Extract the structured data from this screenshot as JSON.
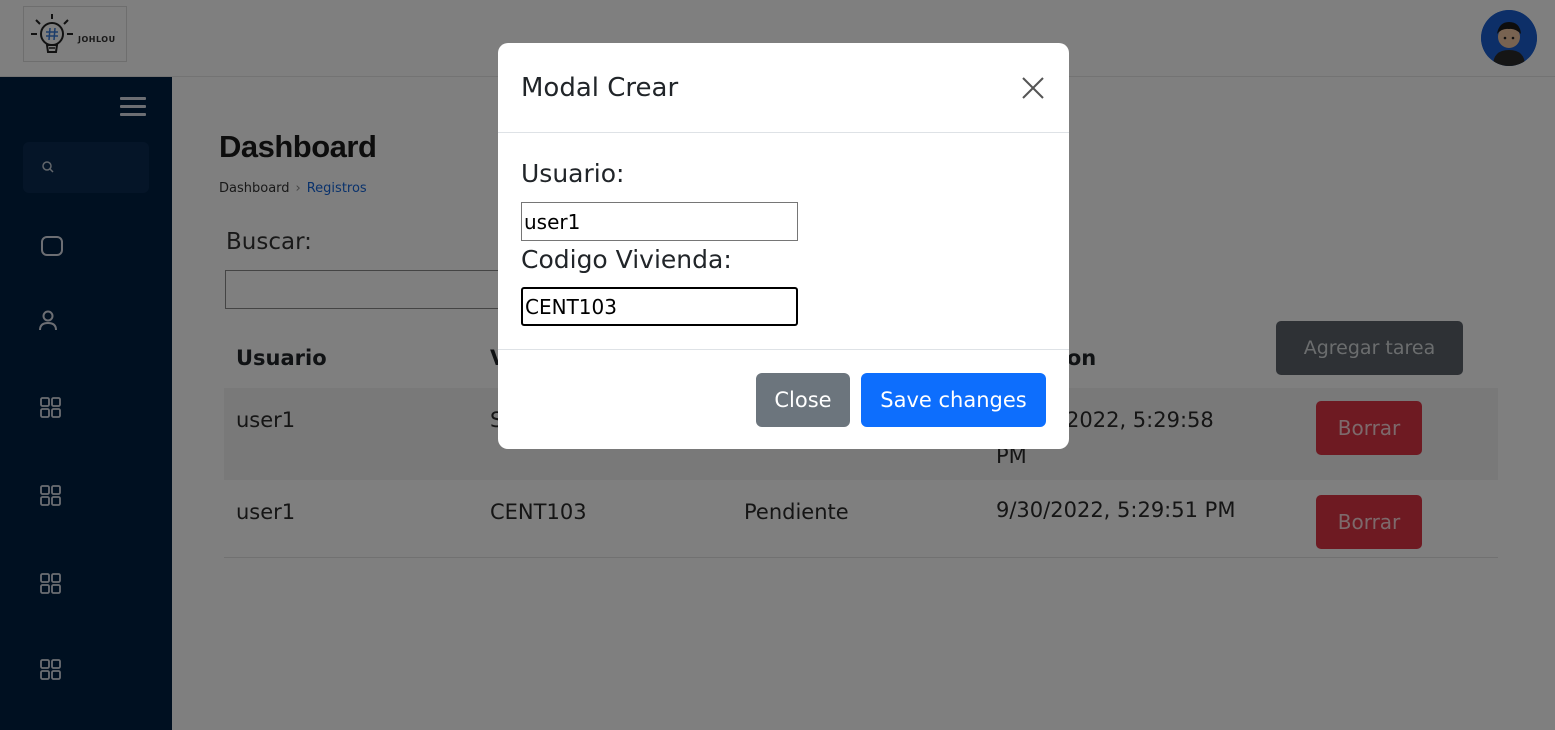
{
  "header": {
    "logo_text": "JOHLOU",
    "avatar_icon": "user-avatar-icon"
  },
  "sidebar": {
    "menu_icon": "hamburger-menu-icon",
    "search_icon": "search-icon",
    "items": [
      {
        "icon": "square-icon"
      },
      {
        "icon": "user-icon"
      },
      {
        "icon": "grid-icon"
      },
      {
        "icon": "grid-icon"
      },
      {
        "icon": "grid-icon"
      },
      {
        "icon": "grid-icon"
      }
    ]
  },
  "main": {
    "title": "Dashboard",
    "breadcrumb": {
      "root": "Dashboard",
      "separator": "›",
      "current": "Registros"
    },
    "search_label": "Buscar:",
    "search_value": "",
    "add_button": "Agregar tarea",
    "table": {
      "headers": [
        "Usuario",
        "V",
        "",
        "creacion"
      ],
      "rows": [
        {
          "usuario": "user1",
          "vivienda": "S",
          "estado": "",
          "fecha_line1": "2022, 5:29:58",
          "fecha_line2": "PM",
          "action": "Borrar"
        },
        {
          "usuario": "user1",
          "vivienda": "CENT103",
          "estado": "Pendiente",
          "fecha_line1": "9/30/2022, 5:29:51 PM",
          "fecha_line2": "",
          "action": "Borrar"
        }
      ]
    }
  },
  "modal": {
    "title": "Modal Crear",
    "close_icon": "close-icon",
    "usuario_label": "Usuario:",
    "usuario_value": "user1",
    "codigo_label": "Codigo Vivienda:",
    "codigo_value": "CENT103",
    "close_button": "Close",
    "save_button": "Save changes"
  },
  "colors": {
    "sidebar": "#012042",
    "primary": "#0d6efd",
    "secondary": "#6c757d",
    "danger": "#dc3545"
  }
}
